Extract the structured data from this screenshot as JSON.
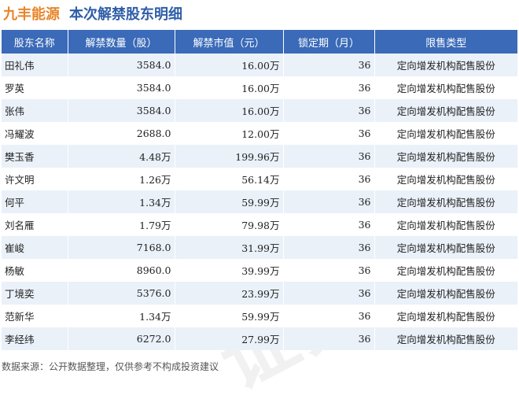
{
  "header": {
    "brand": "九丰能源",
    "subtitle": "本次解禁股东明细"
  },
  "table": {
    "columns": [
      "股东名称",
      "解禁数量（股）",
      "解禁市值（元）",
      "锁定期（月）",
      "限售类型"
    ],
    "rows": [
      [
        "田礼伟",
        "3584.0",
        "16.00万",
        "36",
        "定向增发机构配售股份"
      ],
      [
        "罗英",
        "3584.0",
        "16.00万",
        "36",
        "定向增发机构配售股份"
      ],
      [
        "张伟",
        "3584.0",
        "16.00万",
        "36",
        "定向增发机构配售股份"
      ],
      [
        "冯耀波",
        "2688.0",
        "12.00万",
        "36",
        "定向增发机构配售股份"
      ],
      [
        "樊玉香",
        "4.48万",
        "199.96万",
        "36",
        "定向增发机构配售股份"
      ],
      [
        "许文明",
        "1.26万",
        "56.14万",
        "36",
        "定向增发机构配售股份"
      ],
      [
        "何平",
        "1.34万",
        "59.99万",
        "36",
        "定向增发机构配售股份"
      ],
      [
        "刘名雁",
        "1.79万",
        "79.98万",
        "36",
        "定向增发机构配售股份"
      ],
      [
        "崔峻",
        "7168.0",
        "31.99万",
        "36",
        "定向增发机构配售股份"
      ],
      [
        "杨敏",
        "8960.0",
        "39.99万",
        "36",
        "定向增发机构配售股份"
      ],
      [
        "丁境奕",
        "5376.0",
        "23.99万",
        "36",
        "定向增发机构配售股份"
      ],
      [
        "范新华",
        "1.34万",
        "59.99万",
        "36",
        "定向增发机构配售股份"
      ],
      [
        "李经纬",
        "6272.0",
        "27.99万",
        "36",
        "定向增发机构配售股份"
      ]
    ]
  },
  "footer": {
    "source": "数据来源：公开数据整理，仅供参考不构成投资建议"
  },
  "watermark": "证券之星",
  "colors": {
    "brand": "#e8852a",
    "subtitle": "#2f5ea8",
    "header_bg": "#3a6ab8",
    "row_stripe": "#eaf1f9"
  }
}
